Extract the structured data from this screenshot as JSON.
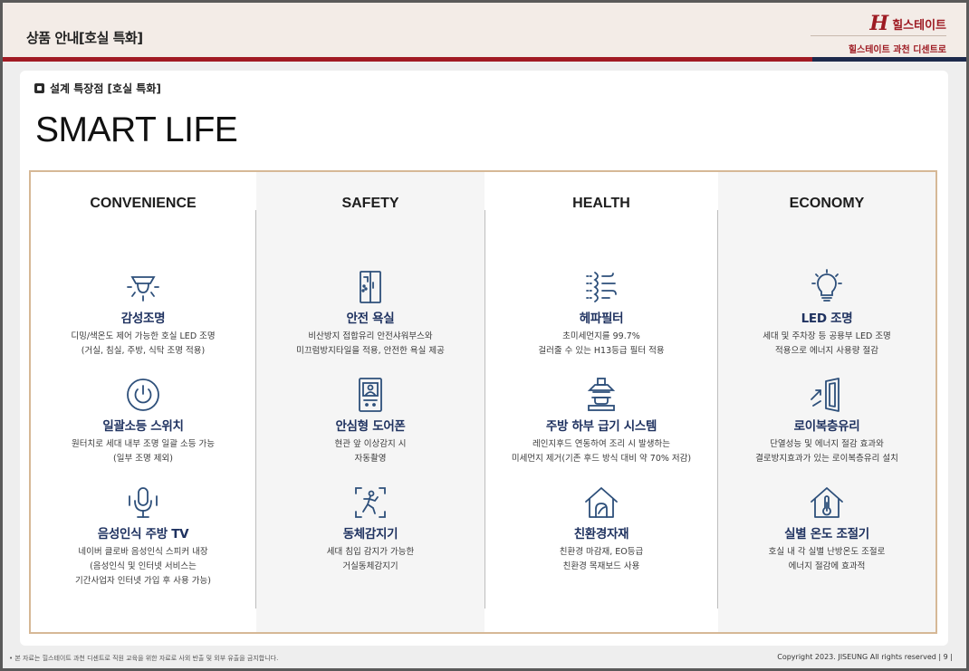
{
  "header": {
    "title": "상품 안내[호실 특화]",
    "brand_mark": "H",
    "brand_name": "힐스테이트",
    "brand_sub": "힐스테이트 과천 디센트로"
  },
  "section": {
    "tag": "설계 특장점 [호실 특화]",
    "title": "SMART LIFE"
  },
  "columns": [
    {
      "heading": "CONVENIENCE",
      "features": [
        {
          "icon": "ceiling-light-icon",
          "title": "감성조명",
          "desc": [
            "디밍/색온도 제어 가능한 호실 LED 조명",
            "(거실, 침실, 주방, 식탁 조명 적용)"
          ]
        },
        {
          "icon": "power-switch-icon",
          "title": "일괄소등 스위치",
          "desc": [
            "원터치로 세대 내부 조명 일괄 소등 가능",
            "(일부 조명 제외)"
          ]
        },
        {
          "icon": "microphone-icon",
          "title": "음성인식 주방 TV",
          "desc": [
            "네이버 클로바 음성인식 스피커 내장",
            "(음성인식 및 인터넷 서비스는",
            "기간사업자 인터넷 가입 후 사용 가능)"
          ]
        }
      ]
    },
    {
      "heading": "SAFETY",
      "features": [
        {
          "icon": "shower-booth-icon",
          "title": "안전 욕실",
          "desc": [
            "비산방지 접합유리 안전샤워부스와",
            "미끄럼방지타일을 적용, 안전한 욕실 제공"
          ]
        },
        {
          "icon": "door-phone-icon",
          "title": "안심형 도어폰",
          "desc": [
            "현관 앞 이상감지 시",
            "자동촬영"
          ]
        },
        {
          "icon": "motion-sensor-icon",
          "title": "동체감지기",
          "desc": [
            "세대 침입 감지가 가능한",
            "거실동체감지기"
          ]
        }
      ]
    },
    {
      "heading": "HEALTH",
      "features": [
        {
          "icon": "air-filter-icon",
          "title": "헤파필터",
          "desc": [
            "초미세먼지를 99.7%",
            "걸러줄 수 있는 H13등급 필터 적용"
          ]
        },
        {
          "icon": "range-hood-icon",
          "title": "주방 하부 급기 시스템",
          "desc": [
            "레인지후드 연동하여 조리 시 발생하는",
            "미세먼지 제거(기존 후드 방식 대비 약 70% 저감)"
          ]
        },
        {
          "icon": "eco-house-icon",
          "title": "친환경자재",
          "desc": [
            "친환경 마감재, EO등급",
            "친환경 목재보드 사용"
          ]
        }
      ]
    },
    {
      "heading": "ECONOMY",
      "features": [
        {
          "icon": "led-bulb-icon",
          "title": "LED 조명",
          "desc": [
            "세대 및 주차장 등 공용부 LED 조명",
            "적용으로 에너지 사용량 절감"
          ]
        },
        {
          "icon": "window-glass-icon",
          "title": "로이복층유리",
          "desc": [
            "단열성능 및 에너지 절감 효과와",
            "결로방지효과가 있는 로이복층유리 설치"
          ]
        },
        {
          "icon": "thermostat-house-icon",
          "title": "실별 온도 조절기",
          "desc": [
            "호실 내 각 실별 난방온도 조절로",
            "에너지 절감에 효과적"
          ]
        }
      ]
    }
  ],
  "footer": {
    "note": "• 본 자료는 힐스테이트 과천 디센트로 직원 교육을 위한 자료로 사외 반출 및 외부 유출을 금지합니다.",
    "copyright": "Copyright 2023. JISEUNG All rights reserved  | 9 |"
  },
  "colors": {
    "accent_red": "#a11b24",
    "accent_navy": "#1d2a4c",
    "panel_border": "#d6b896",
    "title_navy": "#1f3260",
    "icon_blue": "#2d4f7a"
  }
}
